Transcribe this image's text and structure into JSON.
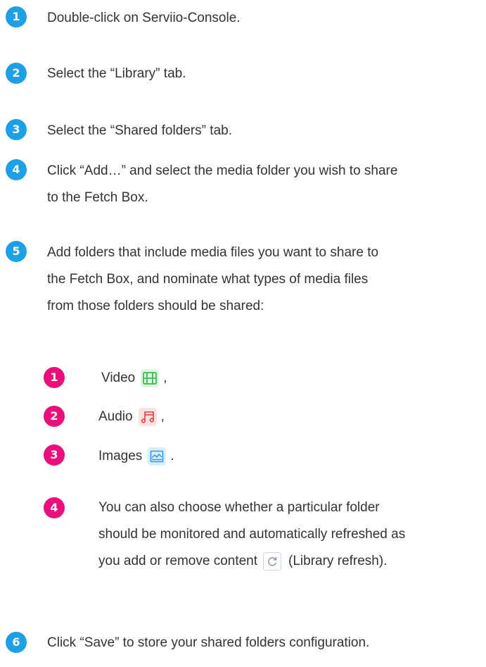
{
  "steps": [
    {
      "num": "1",
      "text": "Double-click on Serviio-Console."
    },
    {
      "num": "2",
      "text": "Select the “Library” tab."
    },
    {
      "num": "3",
      "text": "Select the “Shared folders” tab."
    },
    {
      "num": "4",
      "line1": "Click “Add…” and select the media folder you wish to share",
      "line2": "to the Fetch Box."
    },
    {
      "num": "5",
      "line1": "Add folders that include media files you want to share to",
      "line2": "the Fetch Box, and nominate what types of media files",
      "line3": "from those folders should be shared:"
    },
    {
      "num": "6",
      "text": "Click “Save” to store your shared folders configuration."
    }
  ],
  "substeps": [
    {
      "num": "1",
      "label": "Video",
      "suffix": ",",
      "icon": "film-icon"
    },
    {
      "num": "2",
      "label": "Audio",
      "suffix": ",",
      "icon": "music-note-icon"
    },
    {
      "num": "3",
      "label": "Images",
      "suffix": ".",
      "icon": "image-icon"
    },
    {
      "num": "4",
      "line1": "You can also choose whether a particular folder",
      "line2": "should be monitored and automatically refreshed as",
      "line3_before": "you add or remove content",
      "line3_after": "(Library refresh).",
      "icon": "refresh-icon"
    }
  ],
  "colors": {
    "step_badge": "#1ea0e6",
    "substep_badge": "#ea0f7a",
    "video_icon": "#3dbb55",
    "audio_icon": "#e04040",
    "images_icon": "#2f9be0",
    "refresh_icon": "#8a98a6"
  }
}
